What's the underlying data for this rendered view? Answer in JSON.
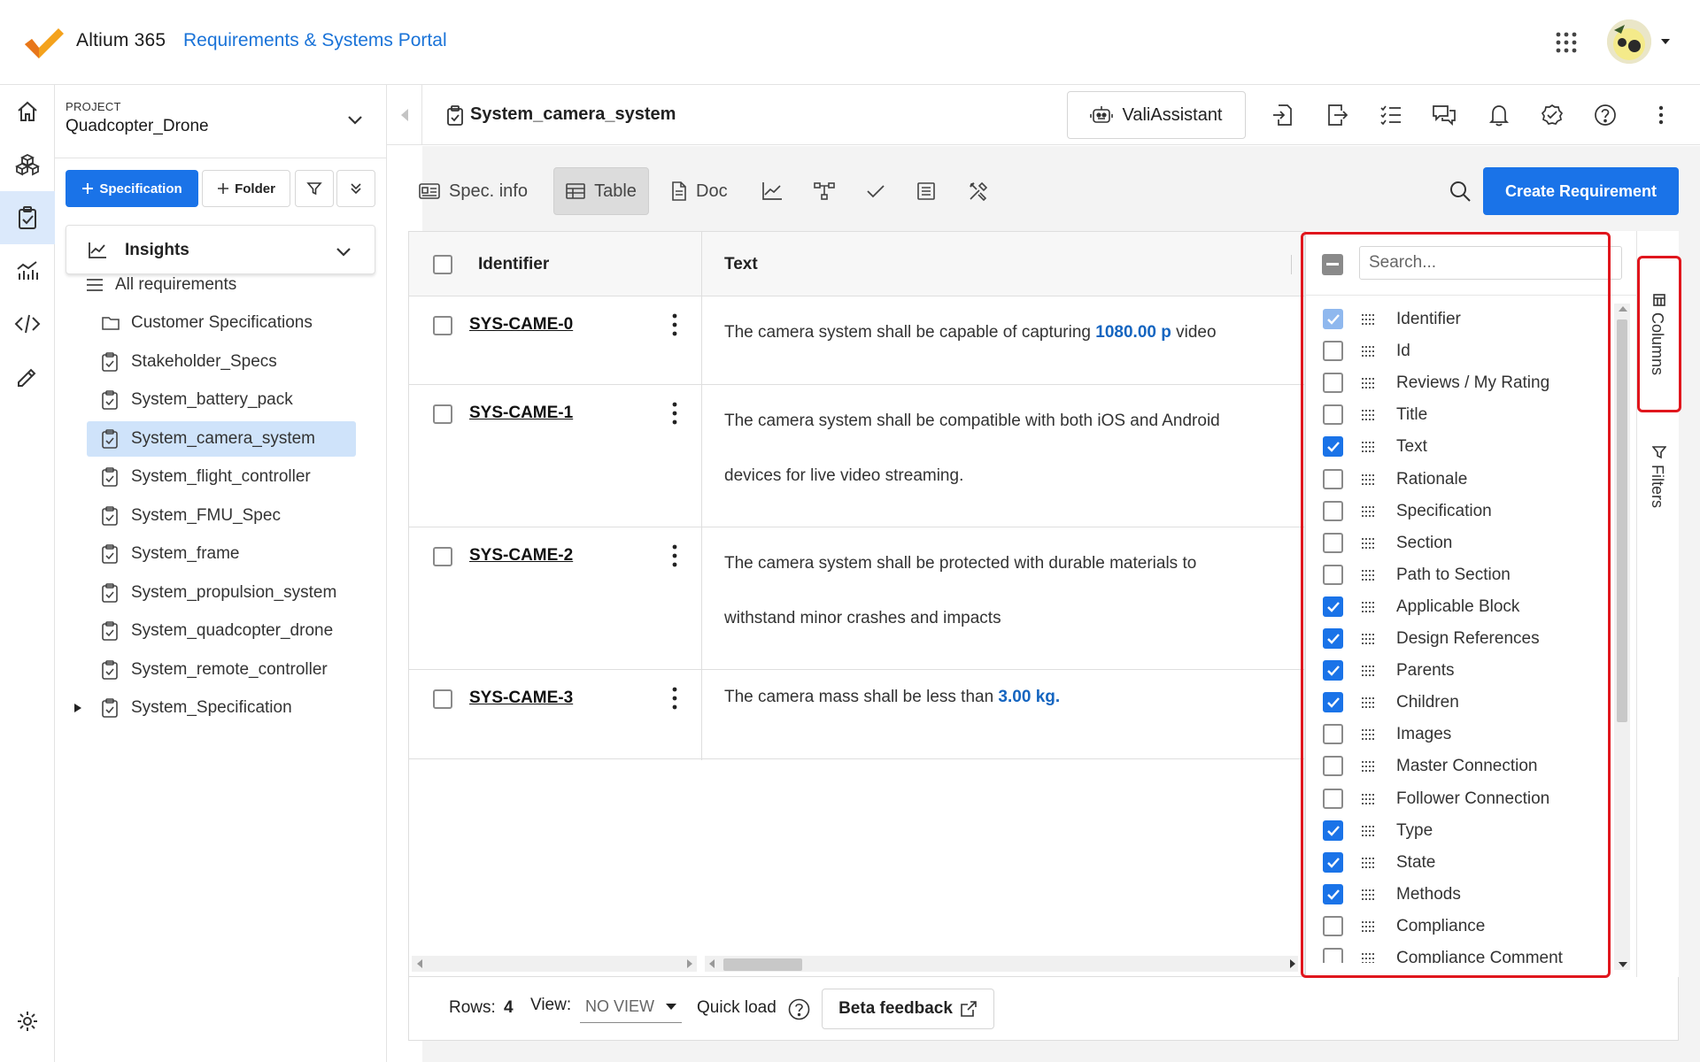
{
  "header": {
    "brand": "Altium 365",
    "portal": "Requirements & Systems Portal",
    "apps_icon": "apps-grid-icon",
    "avatar_icon": "avatar"
  },
  "rail": {
    "items": [
      {
        "icon": "home-icon"
      },
      {
        "icon": "cubes-icon"
      },
      {
        "icon": "clipboard-check-icon",
        "active": true
      },
      {
        "icon": "analytics-icon"
      },
      {
        "icon": "code-icon"
      },
      {
        "icon": "pen-ruler-icon"
      },
      {
        "icon": "settings-icon"
      }
    ]
  },
  "project": {
    "label": "PROJECT",
    "name": "Quadcopter_Drone"
  },
  "sidebar": {
    "spec_button": "Specification",
    "folder_button": "Folder",
    "insights": "Insights",
    "tree": [
      {
        "label": "All requirements",
        "icon": "list-icon"
      },
      {
        "label": "Customer Specifications",
        "icon": "folder-icon"
      },
      {
        "label": "Stakeholder_Specs",
        "icon": "clipboard-icon"
      },
      {
        "label": "System_battery_pack",
        "icon": "clipboard-icon"
      },
      {
        "label": "System_camera_system",
        "icon": "clipboard-icon",
        "selected": true
      },
      {
        "label": "System_flight_controller",
        "icon": "clipboard-icon"
      },
      {
        "label": "System_FMU_Spec",
        "icon": "clipboard-icon"
      },
      {
        "label": "System_frame",
        "icon": "clipboard-icon"
      },
      {
        "label": "System_propulsion_system",
        "icon": "clipboard-icon"
      },
      {
        "label": "System_quadcopter_drone",
        "icon": "clipboard-icon"
      },
      {
        "label": "System_remote_controller",
        "icon": "clipboard-icon"
      },
      {
        "label": "System_Specification",
        "icon": "clipboard-icon",
        "expandable": true
      }
    ]
  },
  "main": {
    "spec_title": "System_camera_system",
    "vali_assistant": "ValiAssistant",
    "header_icons": [
      "import-icon",
      "export-icon",
      "checklist-icon",
      "chat-icon",
      "bell-icon",
      "verified-icon",
      "help-icon",
      "more-vert-icon"
    ],
    "tabs": [
      {
        "label": "Spec. info",
        "icon": "info-card-icon"
      },
      {
        "label": "Table",
        "icon": "table-icon",
        "active": true
      },
      {
        "label": "Doc",
        "icon": "doc-icon"
      },
      {
        "label": "",
        "icon": "chart-line-icon"
      },
      {
        "label": "",
        "icon": "hierarchy-icon"
      },
      {
        "label": "",
        "icon": "check-icon"
      },
      {
        "label": "",
        "icon": "list-alt-icon"
      },
      {
        "label": "",
        "icon": "tools-icon"
      }
    ],
    "create_button": "Create Requirement"
  },
  "table": {
    "columns": [
      "Identifier",
      "Text"
    ],
    "rows": [
      {
        "id": "SYS-CAME-0",
        "parts": [
          "The camera system shall be capable of capturing ",
          "1080.00",
          " ",
          "p",
          " video"
        ]
      },
      {
        "id": "SYS-CAME-1",
        "line1": "The camera system shall be compatible with both iOS and Android",
        "line2": "devices for live video streaming."
      },
      {
        "id": "SYS-CAME-2",
        "line1": "The camera system shall be protected with durable materials to",
        "line2": "withstand minor crashes and impacts"
      },
      {
        "id": "SYS-CAME-3",
        "parts": [
          "The camera mass shall be less than ",
          "3.00",
          " ",
          "kg",
          "."
        ]
      }
    ]
  },
  "footer": {
    "rows_label": "Rows:",
    "rows_value": "4",
    "view_label": "View:",
    "view_value": "NO VIEW",
    "quick_load": "Quick load",
    "beta_feedback": "Beta feedback"
  },
  "columns_panel": {
    "search_placeholder": "Search...",
    "items": [
      {
        "label": "Identifier",
        "checked": true,
        "disabled": true
      },
      {
        "label": "Id",
        "checked": false
      },
      {
        "label": "Reviews / My Rating",
        "checked": false
      },
      {
        "label": "Title",
        "checked": false
      },
      {
        "label": "Text",
        "checked": true
      },
      {
        "label": "Rationale",
        "checked": false
      },
      {
        "label": "Specification",
        "checked": false
      },
      {
        "label": "Section",
        "checked": false
      },
      {
        "label": "Path to Section",
        "checked": false
      },
      {
        "label": "Applicable Block",
        "checked": true
      },
      {
        "label": "Design References",
        "checked": true
      },
      {
        "label": "Parents",
        "checked": true
      },
      {
        "label": "Children",
        "checked": true
      },
      {
        "label": "Images",
        "checked": false
      },
      {
        "label": "Master Connection",
        "checked": false
      },
      {
        "label": "Follower Connection",
        "checked": false
      },
      {
        "label": "Type",
        "checked": true
      },
      {
        "label": "State",
        "checked": true
      },
      {
        "label": "Methods",
        "checked": true
      },
      {
        "label": "Compliance",
        "checked": false
      },
      {
        "label": "Compliance Comment",
        "checked": false
      }
    ]
  },
  "side_tabs": {
    "columns": "Columns",
    "filters": "Filters"
  },
  "colors": {
    "accent": "#1a73e8",
    "link_value": "#1565c0",
    "highlight": "#e0161d",
    "selected_bg": "#cfe3fa"
  }
}
